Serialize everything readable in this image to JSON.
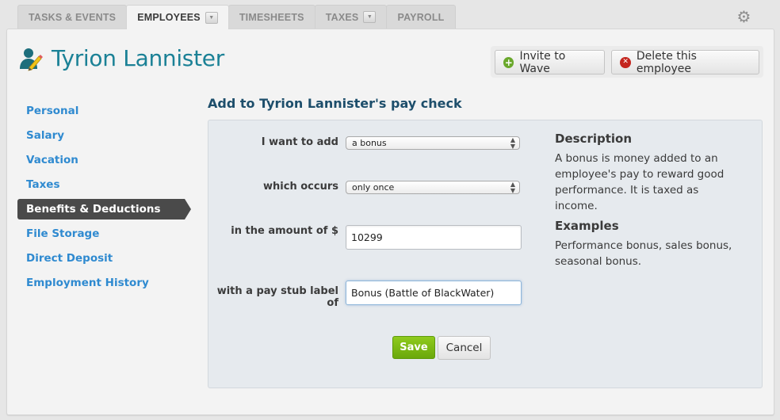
{
  "tabs": [
    {
      "label": "TASKS & EVENTS",
      "active": false,
      "has_menu": false
    },
    {
      "label": "EMPLOYEES",
      "active": true,
      "has_menu": true
    },
    {
      "label": "TIMESHEETS",
      "active": false,
      "has_menu": false
    },
    {
      "label": "TAXES",
      "active": false,
      "has_menu": true
    },
    {
      "label": "PAYROLL",
      "active": false,
      "has_menu": false
    }
  ],
  "icons": {
    "settings": "gear-icon",
    "employee": "person-edit-icon",
    "invite": "plus-circle-icon",
    "delete": "x-circle-icon",
    "menu": "caret-down-icon",
    "select": "up-down-arrows-icon"
  },
  "header": {
    "employee_name": "Tyrion Lannister",
    "invite_label": "Invite to Wave",
    "delete_label": "Delete this employee"
  },
  "sidebar": {
    "items": [
      {
        "label": "Personal",
        "active": false
      },
      {
        "label": "Salary",
        "active": false
      },
      {
        "label": "Vacation",
        "active": false
      },
      {
        "label": "Taxes",
        "active": false
      },
      {
        "label": "Benefits & Deductions",
        "active": true
      },
      {
        "label": "File Storage",
        "active": false
      },
      {
        "label": "Direct Deposit",
        "active": false
      },
      {
        "label": "Employment History",
        "active": false
      }
    ]
  },
  "form": {
    "title": "Add to Tyrion Lannister's pay check",
    "add_type": {
      "label": "I want to add",
      "value": "a bonus"
    },
    "frequency": {
      "label": "which occurs",
      "value": "only once"
    },
    "amount": {
      "label": "in the amount of $",
      "value": "10299"
    },
    "stub_label": {
      "label": "with a pay stub label of",
      "value": "Bonus (Battle of BlackWater)"
    },
    "save_label": "Save",
    "cancel_label": "Cancel"
  },
  "description": {
    "heading": "Description",
    "text": "A bonus is money added to an employee's pay to reward good performance. It is taxed as income.",
    "examples_heading": "Examples",
    "examples_text": "Performance bonus, sales bonus, seasonal bonus."
  },
  "colors": {
    "title": "#1b8196",
    "nav_link": "#2f8ad0",
    "nav_active_bg": "#4a4a4a",
    "save": "#7ab814",
    "delete_icon": "#c4261f",
    "invite_icon": "#6aa82c"
  }
}
